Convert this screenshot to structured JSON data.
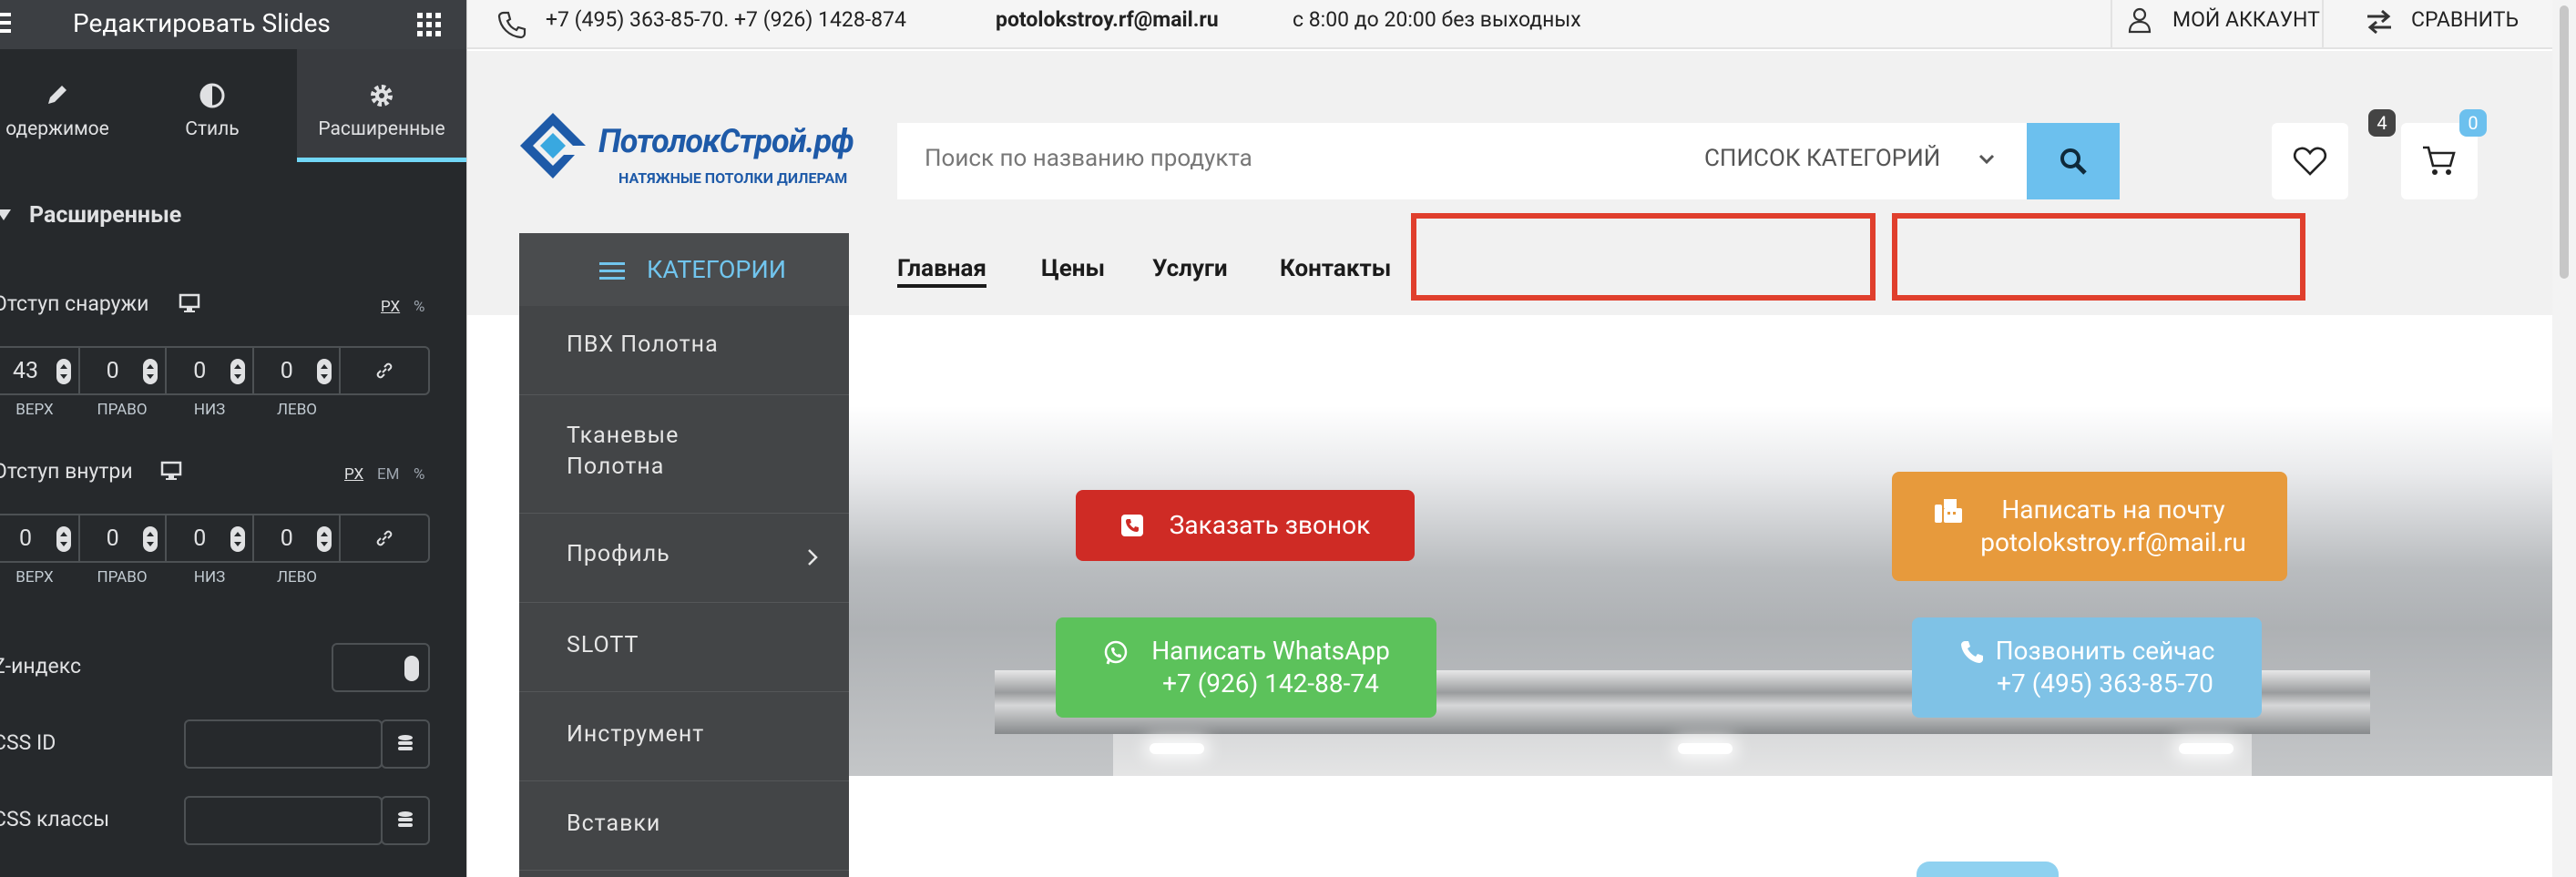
{
  "editor": {
    "title": "Редактировать Slides",
    "tabs": [
      {
        "label": "одержимое",
        "icon": "pencil-icon"
      },
      {
        "label": "Стиль",
        "icon": "half-circle-icon"
      },
      {
        "label": "Расширенные",
        "icon": "gear-icon"
      }
    ],
    "active_tab": "Расширенные",
    "section_title": "Расширенные",
    "margin": {
      "label": "Отступ снаружи",
      "units": [
        "PX",
        "%"
      ],
      "active_unit": "PX",
      "values": [
        "43",
        "0",
        "0",
        "0"
      ],
      "sides": [
        "ВЕРХ",
        "ПРАВО",
        "НИЗ",
        "ЛЕВО"
      ]
    },
    "padding": {
      "label": "Отступ внутри",
      "units": [
        "PX",
        "EM",
        "%"
      ],
      "active_unit": "PX",
      "values": [
        "0",
        "0",
        "0",
        "0"
      ],
      "sides": [
        "ВЕРХ",
        "ПРАВО",
        "НИЗ",
        "ЛЕВО"
      ]
    },
    "zindex_label": "Z-индекс",
    "css_id_label": "CSS ID",
    "css_classes_label": "CSS классы"
  },
  "topbar": {
    "phones": "+7 (495) 363-85-70. +7 (926) 1428-874",
    "email": "potolokstroy.rf@mail.ru",
    "hours": "с 8:00 до 20:00 без выходных",
    "account": "МОЙ АККАУНТ",
    "compare": "СРАВНИТЬ"
  },
  "logo": {
    "name": "ПотолокСтрой.рф",
    "tagline": "НАТЯЖНЫЕ ПОТОЛКИ ДИЛЕРАМ"
  },
  "search": {
    "placeholder": "Поиск по названию продукта",
    "category_select": "СПИСОК КАТЕГОРИЙ"
  },
  "header_icons": {
    "wishlist_count": "4",
    "cart_count": "0"
  },
  "categories": {
    "title": "КАТЕГОРИИ",
    "items": [
      {
        "label": "ПВХ Полотна"
      },
      {
        "label": "Тканевые Полотна"
      },
      {
        "label": "Профиль",
        "has_submenu": true
      },
      {
        "label": "SLOTT"
      },
      {
        "label": "Инструмент"
      },
      {
        "label": "Вставки"
      }
    ]
  },
  "nav": {
    "items": [
      "Главная",
      "Цены",
      "Услуги",
      "Контакты"
    ],
    "active": "Главная"
  },
  "hero_buttons": {
    "call_order": "Заказать звонок",
    "email_line1": "Написать на почту",
    "email_line2": "potolokstroy.rf@mail.ru",
    "whatsapp_line1": "Написать WhatsApp",
    "whatsapp_line2": "+7 (926) 142-88-74",
    "call_now_line1": "Позвонить сейчас",
    "call_now_line2": "+7 (495) 363-85-70"
  },
  "colors": {
    "panel_bg": "#26292c",
    "accent_blue": "#6cc0ee",
    "red_highlight": "#e03f2d",
    "cta_red": "#cf2b25",
    "cta_orange": "#e79a3c",
    "cta_green": "#5cc25b",
    "cta_lightblue": "#7fc2e6"
  }
}
